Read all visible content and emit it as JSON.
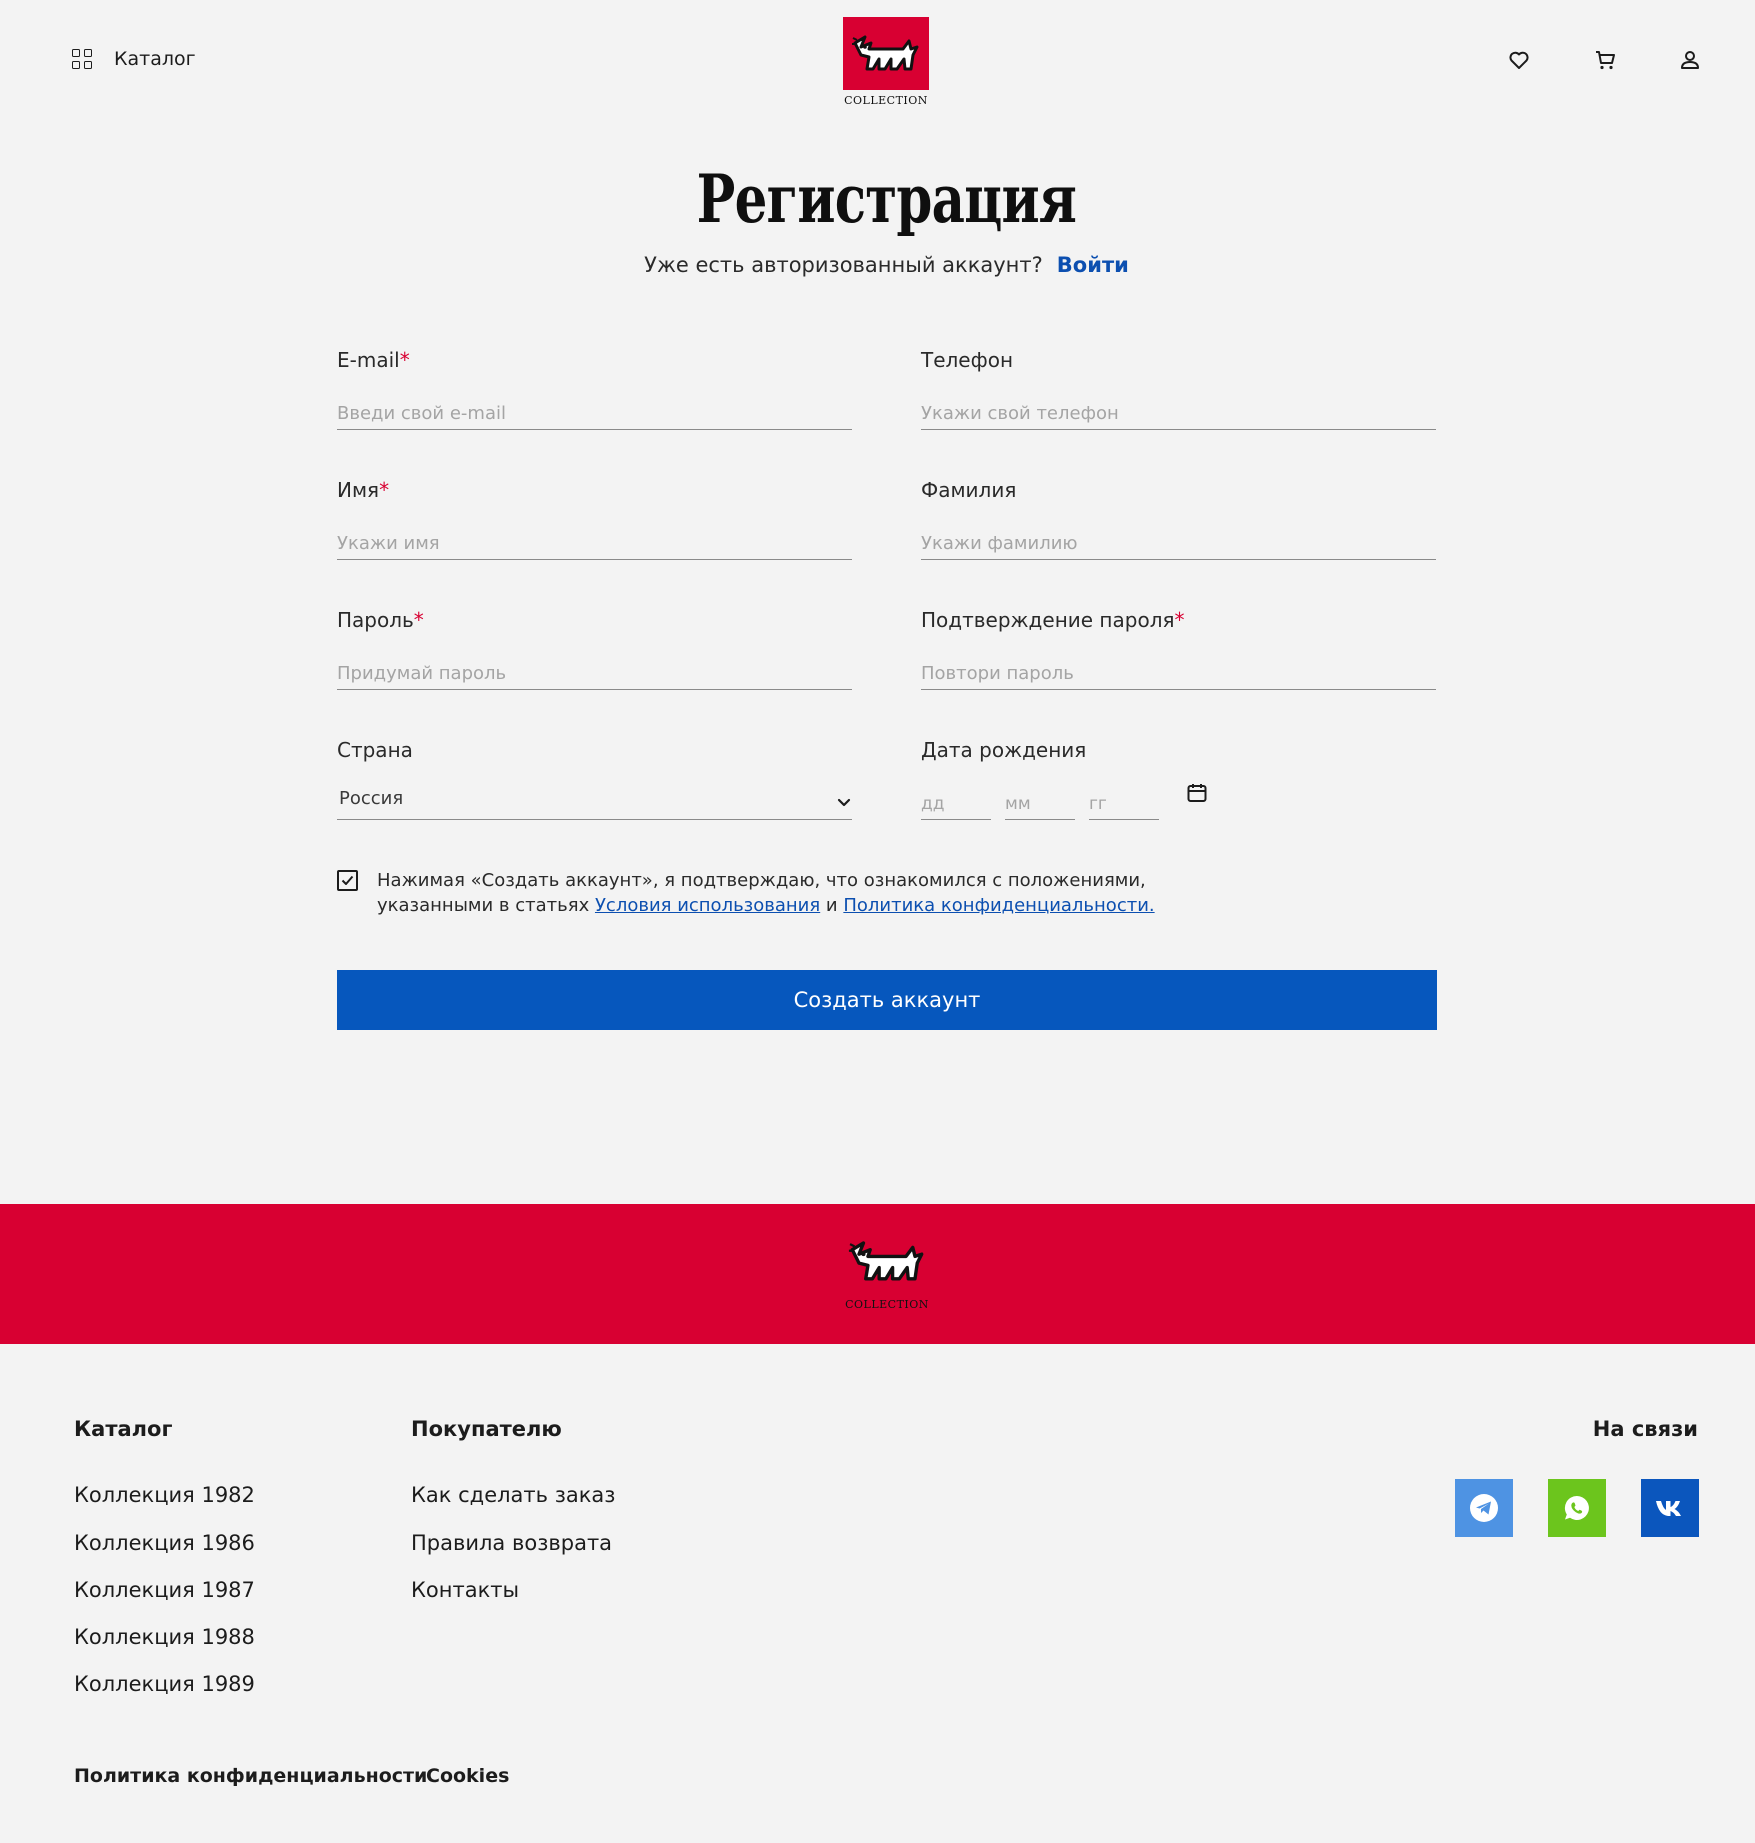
{
  "header": {
    "catalog_label": "Каталог",
    "logo_word": "COLLECTION",
    "icons": [
      "heart-icon",
      "cart-icon",
      "user-icon"
    ]
  },
  "page": {
    "title": "Регистрация",
    "login_prompt": "Уже есть авторизованный аккаунт?",
    "login_link": "Войти"
  },
  "form": {
    "email": {
      "label": "E-mail",
      "required": "*",
      "placeholder": "Введи свой e-mail"
    },
    "phone": {
      "label": "Телефон",
      "placeholder": "Укажи свой телефон"
    },
    "first_name": {
      "label": "Имя",
      "required": "*",
      "placeholder": "Укажи имя"
    },
    "last_name": {
      "label": "Фамилия",
      "placeholder": "Укажи фамилию"
    },
    "password": {
      "label": "Пароль",
      "required": "*",
      "placeholder": "Придумай пароль"
    },
    "password_confirm": {
      "label": "Подтверждение пароля",
      "required": "*",
      "placeholder": "Повтори пароль"
    },
    "country": {
      "label": "Страна",
      "value": "Россия"
    },
    "birthdate": {
      "label": "Дата рождения",
      "day_placeholder": "дд",
      "month_placeholder": "мм",
      "year_placeholder": "гг"
    },
    "consent": {
      "checked": true,
      "text_before": "Нажимая «Создать аккаунт», я подтверждаю, что ознакомился с положениями, указанными в статьях ",
      "terms_link": "Условия использования",
      "text_and": " и ",
      "privacy_link": "Политика конфиденциальности."
    },
    "submit_label": "Создать аккаунт"
  },
  "footer": {
    "logo_word": "COLLECTION",
    "catalog": {
      "title": "Каталог",
      "items": [
        "Коллекция 1982",
        "Коллекция 1986",
        "Коллекция 1987",
        "Коллекция 1988",
        "Коллекция 1989"
      ]
    },
    "buyer": {
      "title": "Покупателю",
      "items": [
        "Как сделать заказ",
        "Правила возврата",
        "Контакты"
      ]
    },
    "contact": {
      "title": "На связи",
      "socials": [
        {
          "name": "telegram-icon",
          "color": "#4e93e3"
        },
        {
          "name": "whatsapp-icon",
          "color": "#6cc51d"
        },
        {
          "name": "vk-icon",
          "color": "#0b56bd"
        }
      ]
    },
    "bottom_links": [
      "Политика конфиденциальности",
      "Cookies"
    ]
  },
  "colors": {
    "brand_red": "#d80032",
    "accent_blue": "#0657bd",
    "background": "#f3f3f3"
  }
}
